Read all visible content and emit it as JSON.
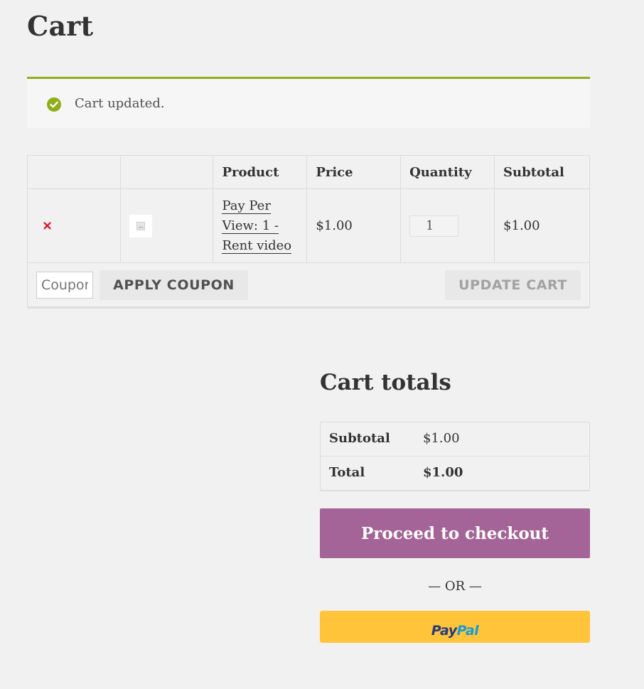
{
  "page": {
    "title": "Cart"
  },
  "notice": {
    "message": "Cart updated."
  },
  "cart_table": {
    "headers": [
      "",
      "",
      "Product",
      "Price",
      "Quantity",
      "Subtotal"
    ],
    "items": [
      {
        "remove_symbol": "×",
        "product_name_lines": [
          "Pay Per",
          "View: 1 -",
          "Rent video"
        ],
        "price": "$1.00",
        "quantity": "1",
        "subtotal": "$1.00"
      }
    ],
    "coupon_placeholder": "Coupon code",
    "apply_coupon_label": "APPLY COUPON",
    "update_cart_label": "UPDATE CART"
  },
  "totals": {
    "heading": "Cart totals",
    "rows": [
      {
        "label": "Subtotal",
        "value": "$1.00"
      },
      {
        "label": "Total",
        "value": "$1.00"
      }
    ],
    "checkout_label": "Proceed to checkout",
    "or_text": "— OR —",
    "paypal_part1": "Pay",
    "paypal_part2": "Pal"
  },
  "colors": {
    "notice_accent": "#8fae1b",
    "remove": "#e2001a",
    "checkout_bg": "#a46497",
    "paypal_bg": "#ffc439",
    "paypal_dark": "#253b80",
    "paypal_light": "#179bd7"
  },
  "icons": {
    "notice": "check-circle-icon",
    "remove": "remove-x-icon",
    "thumbnail": "image-placeholder-icon"
  }
}
